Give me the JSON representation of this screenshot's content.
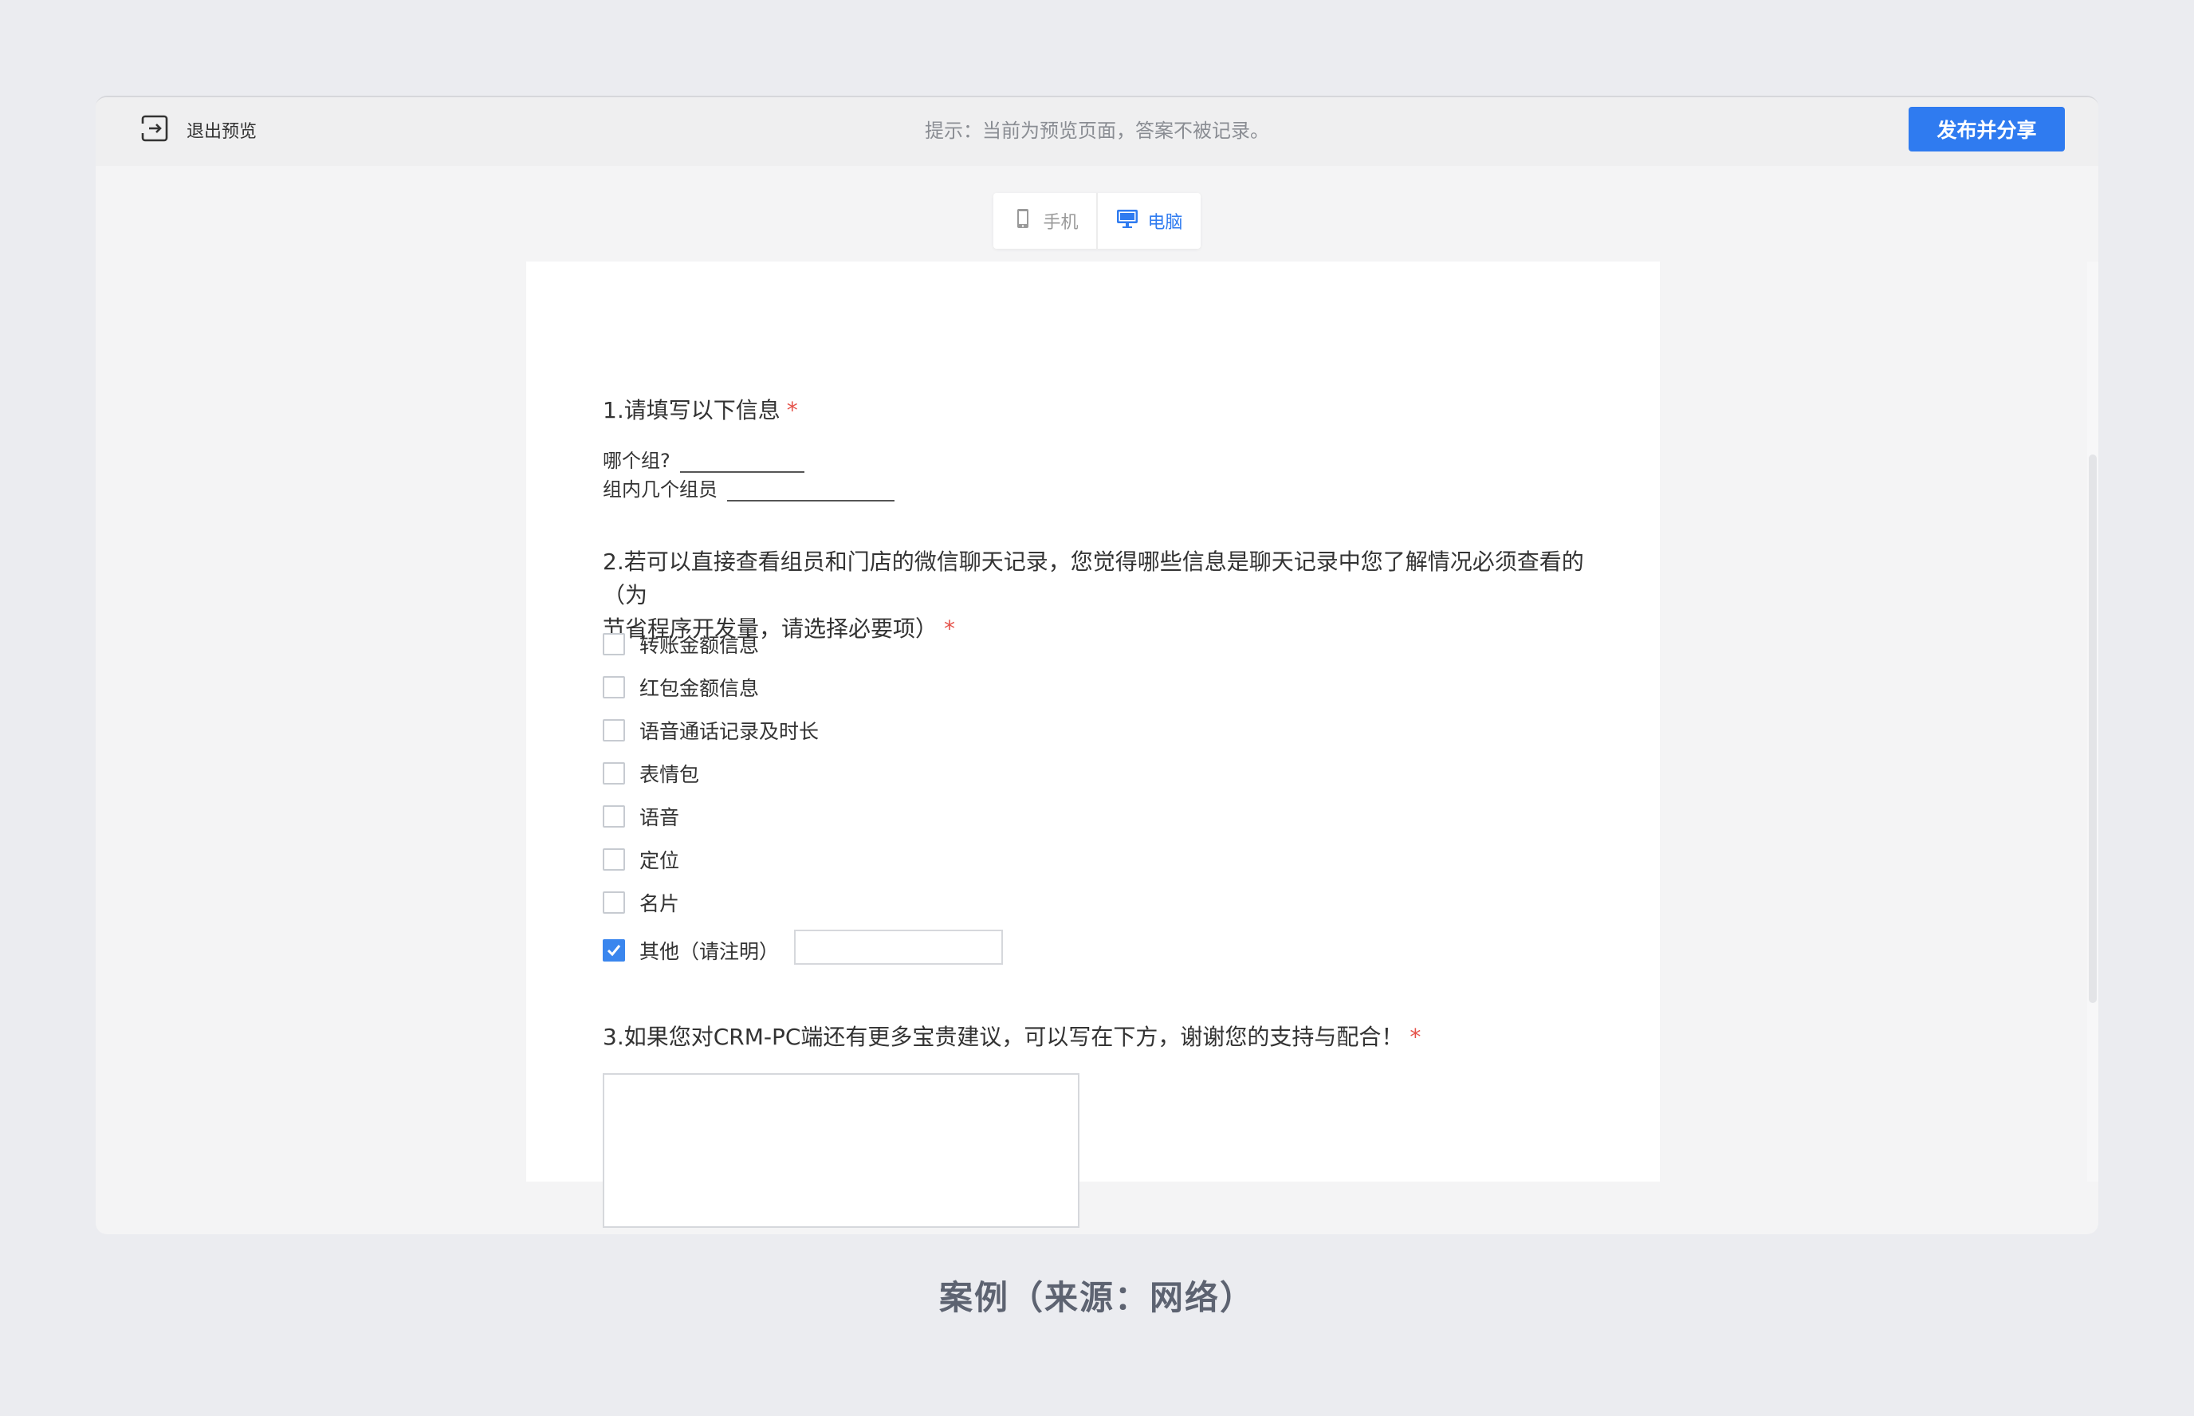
{
  "header": {
    "exit_label": "退出预览",
    "hint": "提示：当前为预览页面，答案不被记录。",
    "publish_label": "发布并分享"
  },
  "toggle": {
    "mobile_label": "手机",
    "pc_label": "电脑",
    "active": "pc"
  },
  "questions": {
    "q1": {
      "title": "1.请填写以下信息",
      "required_mark": "*",
      "fields": [
        "哪个组?",
        "组内几个组员"
      ]
    },
    "q2": {
      "title_line1": "2.若可以直接查看组员和门店的微信聊天记录，您觉得哪些信息是聊天记录中您了解情况必须查看的（为",
      "title_line2": "节省程序开发量，请选择必要项）",
      "required_mark": "*",
      "options": [
        {
          "label": "转账金额信息",
          "checked": false
        },
        {
          "label": "红包金额信息",
          "checked": false
        },
        {
          "label": "语音通话记录及时长",
          "checked": false
        },
        {
          "label": "表情包",
          "checked": false
        },
        {
          "label": "语音",
          "checked": false
        },
        {
          "label": "定位",
          "checked": false
        },
        {
          "label": "名片",
          "checked": false
        },
        {
          "label": "其他（请注明）",
          "checked": true
        }
      ],
      "other_value": ""
    },
    "q3": {
      "title": "3.如果您对CRM-PC端还有更多宝贵建议，可以写在下方，谢谢您的支持与配合！",
      "required_mark": "*",
      "answer": ""
    }
  },
  "caption": "案例（来源：网络）",
  "colors": {
    "accent": "#2f7bf0",
    "required": "#e5534b",
    "background": "#ebecf0"
  }
}
